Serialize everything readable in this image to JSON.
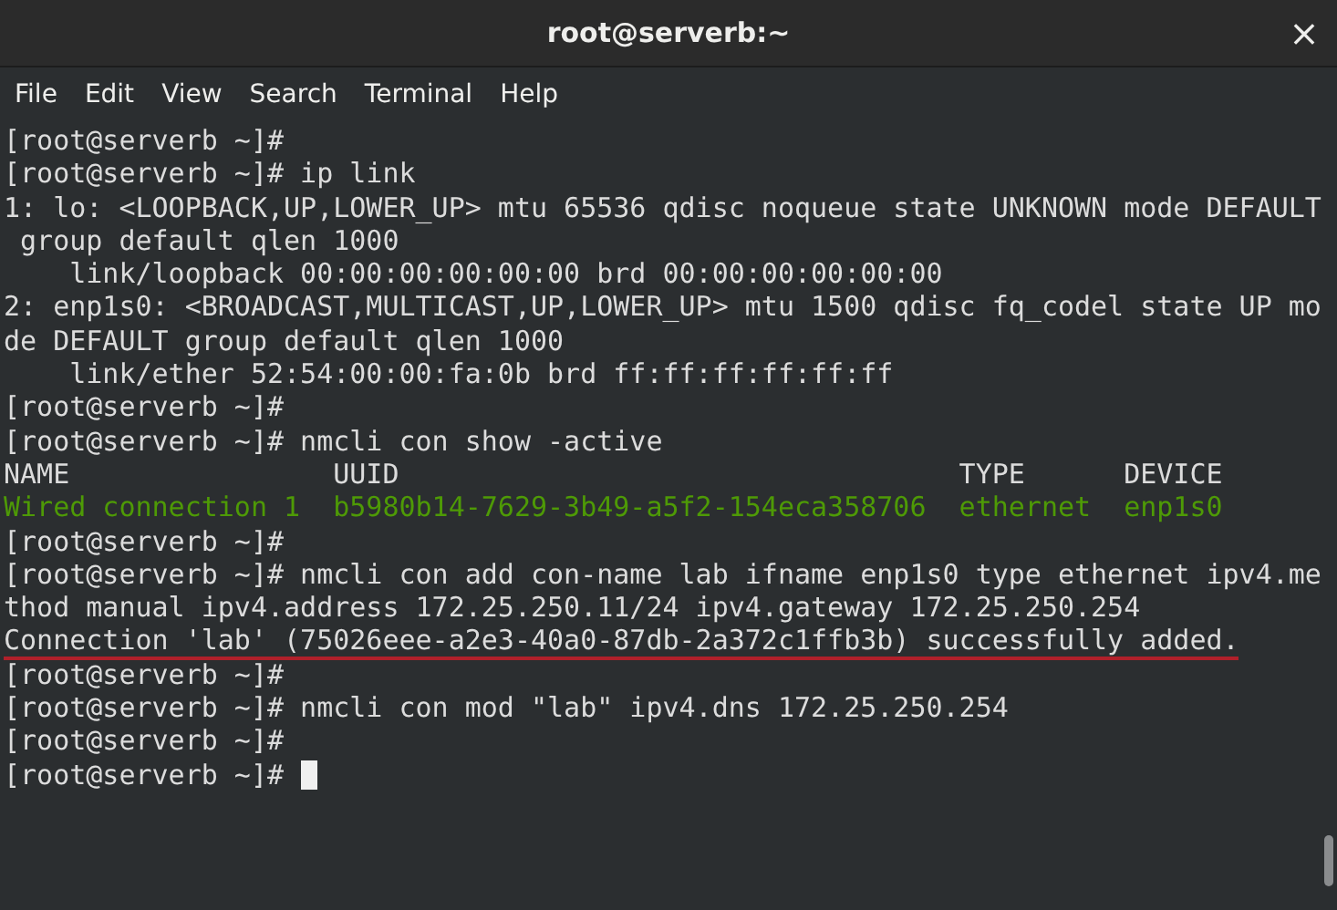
{
  "window": {
    "title": "root@serverb:~",
    "close": "×"
  },
  "menu": [
    "File",
    "Edit",
    "View",
    "Search",
    "Terminal",
    "Help"
  ],
  "terminal": {
    "lines": [
      {
        "kind": "text",
        "text": "[root@serverb ~]#"
      },
      {
        "kind": "text",
        "text": "[root@serverb ~]# ip link"
      },
      {
        "kind": "text",
        "text": "1: lo: <LOOPBACK,UP,LOWER_UP> mtu 65536 qdisc noqueue state UNKNOWN mode DEFAULT"
      },
      {
        "kind": "text",
        "text": " group default qlen 1000"
      },
      {
        "kind": "text",
        "text": "    link/loopback 00:00:00:00:00:00 brd 00:00:00:00:00:00"
      },
      {
        "kind": "text",
        "text": "2: enp1s0: <BROADCAST,MULTICAST,UP,LOWER_UP> mtu 1500 qdisc fq_codel state UP mo"
      },
      {
        "kind": "text",
        "text": "de DEFAULT group default qlen 1000"
      },
      {
        "kind": "text",
        "text": "    link/ether 52:54:00:00:fa:0b brd ff:ff:ff:ff:ff:ff"
      },
      {
        "kind": "text",
        "text": "[root@serverb ~]#"
      },
      {
        "kind": "text",
        "text": "[root@serverb ~]# nmcli con show -active"
      },
      {
        "kind": "text",
        "text": "NAME                UUID                                  TYPE      DEVICE"
      },
      {
        "kind": "active",
        "text": "Wired connection 1  b5980b14-7629-3b49-a5f2-154eca358706  ethernet  enp1s0"
      },
      {
        "kind": "text",
        "text": "[root@serverb ~]#"
      },
      {
        "kind": "text",
        "text": "[root@serverb ~]# nmcli con add con-name lab ifname enp1s0 type ethernet ipv4.me"
      },
      {
        "kind": "text",
        "text": "thod manual ipv4.address 172.25.250.11/24 ipv4.gateway 172.25.250.254"
      },
      {
        "kind": "underlined",
        "text": "Connection 'lab' (75026eee-a2e3-40a0-87db-2a372c1ffb3b) successfully added."
      },
      {
        "kind": "text",
        "text": "[root@serverb ~]#"
      },
      {
        "kind": "text",
        "text": "[root@serverb ~]# nmcli con mod \"lab\" ipv4.dns 172.25.250.254"
      },
      {
        "kind": "text",
        "text": "[root@serverb ~]#"
      },
      {
        "kind": "prompt",
        "text": "[root@serverb ~]# "
      }
    ]
  }
}
